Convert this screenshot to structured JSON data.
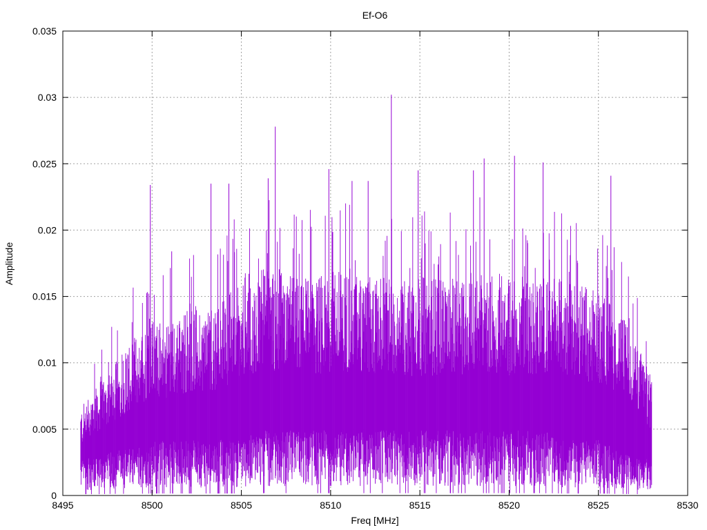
{
  "chart_data": {
    "type": "line",
    "title": "Ef-O6",
    "xlabel": "Freq [MHz]",
    "ylabel": "Amplitude",
    "xlim": [
      8495,
      8530
    ],
    "ylim": [
      0,
      0.035
    ],
    "xticks": [
      "8495",
      "8500",
      "8505",
      "8510",
      "8515",
      "8520",
      "8525",
      "8530"
    ],
    "xtick_values": [
      8495,
      8500,
      8505,
      8510,
      8515,
      8520,
      8525,
      8530
    ],
    "yticks": [
      "0",
      "0.005",
      "0.01",
      "0.015",
      "0.02",
      "0.025",
      "0.03",
      "0.035"
    ],
    "ytick_values": [
      0,
      0.005,
      0.01,
      0.015,
      0.02,
      0.025,
      0.03,
      0.035
    ],
    "grid": true,
    "series_color": "#9400d3",
    "data_range": [
      8496,
      8528
    ],
    "envelope": {
      "x": [
        8496,
        8497,
        8498,
        8499,
        8500,
        8501,
        8502,
        8503,
        8504,
        8505,
        8506,
        8507,
        8508,
        8509,
        8510,
        8511,
        8512,
        8513,
        8514,
        8515,
        8516,
        8517,
        8518,
        8519,
        8520,
        8521,
        8522,
        8523,
        8524,
        8525,
        8526,
        8527,
        8528
      ],
      "upper": [
        0.006,
        0.008,
        0.0095,
        0.011,
        0.012,
        0.012,
        0.013,
        0.013,
        0.0135,
        0.015,
        0.0155,
        0.0155,
        0.015,
        0.015,
        0.0155,
        0.0155,
        0.015,
        0.015,
        0.015,
        0.015,
        0.015,
        0.015,
        0.0155,
        0.0155,
        0.015,
        0.015,
        0.015,
        0.015,
        0.0145,
        0.014,
        0.013,
        0.011,
        0.008
      ],
      "lower": [
        0.002,
        0.002,
        0.0025,
        0.0025,
        0.003,
        0.003,
        0.003,
        0.003,
        0.003,
        0.003,
        0.0035,
        0.0035,
        0.0035,
        0.0035,
        0.0035,
        0.0035,
        0.0035,
        0.0035,
        0.0035,
        0.0035,
        0.0035,
        0.0035,
        0.0035,
        0.0035,
        0.0035,
        0.0035,
        0.0035,
        0.003,
        0.003,
        0.003,
        0.0025,
        0.002,
        0.002
      ]
    },
    "peaks": [
      {
        "x": 8499.9,
        "y": 0.0234
      },
      {
        "x": 8501.1,
        "y": 0.0184
      },
      {
        "x": 8503.3,
        "y": 0.0235
      },
      {
        "x": 8504.3,
        "y": 0.0235
      },
      {
        "x": 8506.5,
        "y": 0.0239
      },
      {
        "x": 8506.9,
        "y": 0.0278
      },
      {
        "x": 8509.9,
        "y": 0.0246
      },
      {
        "x": 8511.2,
        "y": 0.0237
      },
      {
        "x": 8512.1,
        "y": 0.0237
      },
      {
        "x": 8513.4,
        "y": 0.0302
      },
      {
        "x": 8514.9,
        "y": 0.0245
      },
      {
        "x": 8518.0,
        "y": 0.0245
      },
      {
        "x": 8518.6,
        "y": 0.0254
      },
      {
        "x": 8520.3,
        "y": 0.0256
      },
      {
        "x": 8521.9,
        "y": 0.0251
      },
      {
        "x": 8525.7,
        "y": 0.0241
      },
      {
        "x": 8527.4,
        "y": 0.0101
      }
    ]
  }
}
